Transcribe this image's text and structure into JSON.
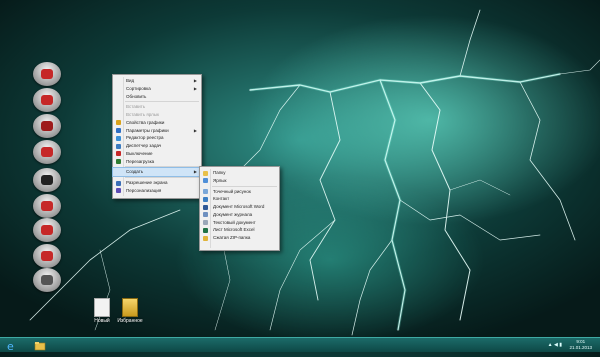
{
  "context_menu": {
    "items": [
      {
        "label": "Вид",
        "arrow": true,
        "disabled": false
      },
      {
        "label": "Сортировка",
        "arrow": true,
        "disabled": false
      },
      {
        "label": "Обновить",
        "arrow": false,
        "disabled": false
      },
      {
        "sep": true
      },
      {
        "label": "Вставить",
        "arrow": false,
        "disabled": true
      },
      {
        "label": "Вставить ярлык",
        "arrow": false,
        "disabled": true
      },
      {
        "label": "Свойства графики",
        "arrow": false,
        "disabled": false,
        "icon_color": "#d9a21b"
      },
      {
        "label": "Параметры графики",
        "arrow": true,
        "disabled": false,
        "icon_color": "#2f6fc4"
      },
      {
        "label": "Редактор реестра",
        "arrow": false,
        "disabled": false,
        "icon_color": "#3a8fd6"
      },
      {
        "label": "Диспетчер задач",
        "arrow": false,
        "disabled": false,
        "icon_color": "#3c7bbf"
      },
      {
        "label": "Выключение",
        "arrow": false,
        "disabled": false,
        "icon_color": "#c62828"
      },
      {
        "label": "Перезагрузка",
        "arrow": false,
        "disabled": false,
        "icon_color": "#2e7d32"
      },
      {
        "sep": true
      },
      {
        "label": "Создать",
        "arrow": true,
        "disabled": false,
        "highlight": true
      },
      {
        "sep": true
      },
      {
        "label": "Разрешение экрана",
        "arrow": false,
        "disabled": false,
        "icon_color": "#3b6fb6"
      },
      {
        "label": "Персонализация",
        "arrow": false,
        "disabled": false,
        "icon_color": "#5b4bb4"
      }
    ]
  },
  "submenu": {
    "items": [
      {
        "label": "Папку",
        "icon_color": "#e8c04a"
      },
      {
        "label": "Ярлык",
        "icon_color": "#4f8fd8"
      },
      {
        "sep": true
      },
      {
        "label": "Точечный рисунок",
        "icon_color": "#7aa7d8"
      },
      {
        "label": "Контакт",
        "icon_color": "#3b7fc4"
      },
      {
        "label": "Документ Microsoft Word",
        "icon_color": "#2b5797"
      },
      {
        "label": "Документ журнала",
        "icon_color": "#6d8fbf"
      },
      {
        "label": "Текстовый документ",
        "icon_color": "#9aa7b8"
      },
      {
        "label": "Лист Microsoft Excel",
        "icon_color": "#1e7145"
      },
      {
        "label": "Сжатая ZIP-папка",
        "icon_color": "#e0b43a"
      }
    ]
  },
  "desktop_files": [
    {
      "label": "Новый"
    },
    {
      "label": "Избранное"
    }
  ],
  "desktop_icons": [
    {
      "name": "app-icon-1",
      "color": "#c62828"
    },
    {
      "name": "app-icon-2",
      "color": "#c62828"
    },
    {
      "name": "app-icon-3",
      "color": "#9e1b1b"
    },
    {
      "name": "app-icon-4",
      "color": "#c62828"
    },
    {
      "name": "app-icon-5",
      "color": "#222222"
    },
    {
      "name": "app-icon-6",
      "color": "#c62828"
    },
    {
      "name": "app-icon-7",
      "color": "#c62828"
    },
    {
      "name": "app-icon-8",
      "color": "#c62828"
    },
    {
      "name": "recycle-bin-icon",
      "color": "#555555"
    }
  ],
  "taskbar": {
    "tray": "▲ ◀ ▮",
    "time": "9:01",
    "date": "21.01.2013",
    "accent": "#3fa9a3"
  }
}
